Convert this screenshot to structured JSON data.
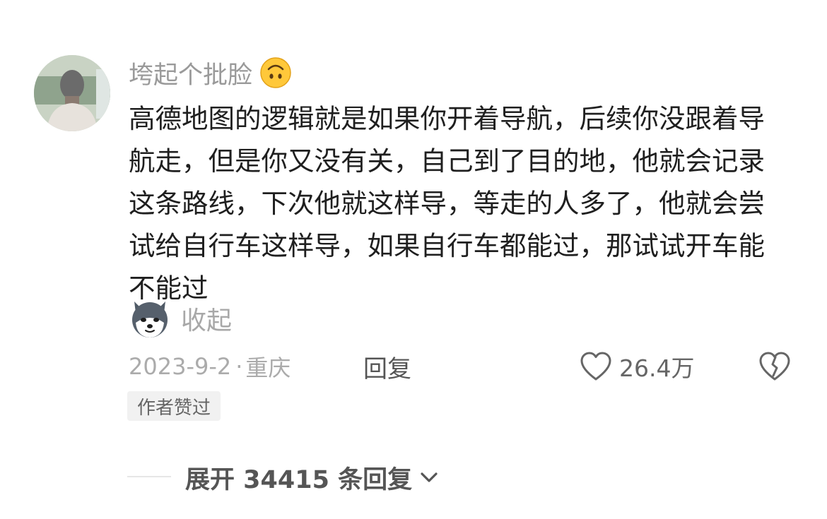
{
  "comment": {
    "username": "垮起个批脸",
    "username_emoji": "upside-down-face-icon",
    "text": "高德地图的逻辑就是如果你开着导航，后续你没跟着导航走，但是你又没有关，自己到了目的地，他就会记录这条路线，下次他就这样导，等走的人多了，他就会尝试给自行车这样导，如果自行车都能过，那试试开车能不能过",
    "sticker": "husky-dog-sticker",
    "collapse_label": "收起",
    "date": "2023-9-2",
    "location": "重庆",
    "reply_label": "回复",
    "like_count": "26.4万",
    "author_badge": "作者赞过"
  },
  "replies": {
    "expand_label": "展开 34415 条回复"
  },
  "colors": {
    "text_primary": "#1f1f1f",
    "text_secondary": "#ababab",
    "badge_bg": "#f1f1f1"
  }
}
